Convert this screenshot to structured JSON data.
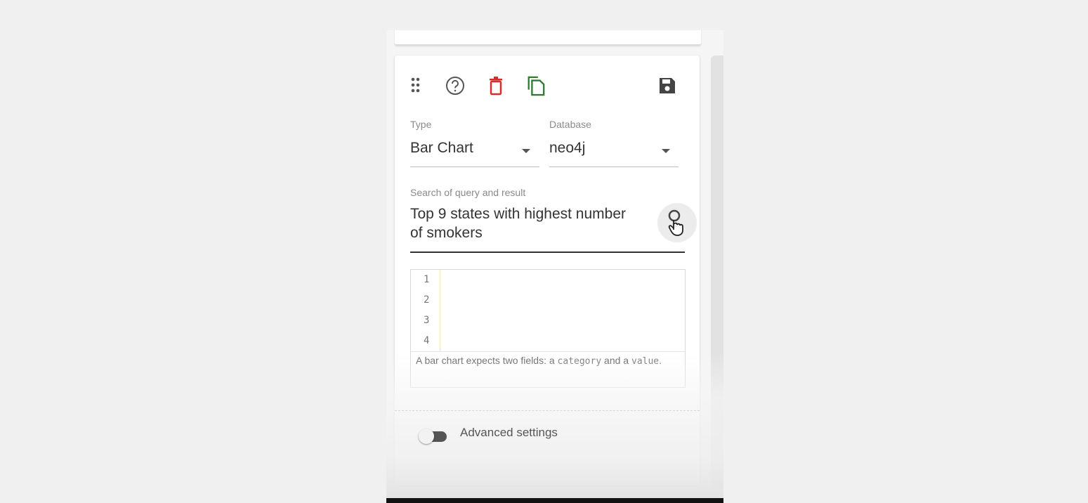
{
  "toolbar": {
    "icons": {
      "drag": "drag-handle-icon",
      "help": "help-circle-icon",
      "delete": "trash-icon",
      "duplicate": "copy-icon",
      "save": "save-icon"
    },
    "colors": {
      "delete": "#d32f2f",
      "duplicate": "#2e7d32",
      "default": "#555555"
    }
  },
  "type_select": {
    "label": "Type",
    "value": "Bar Chart"
  },
  "database_select": {
    "label": "Database",
    "value": "neo4j"
  },
  "search": {
    "label": "Search of query and result",
    "value": "Top 9 states with highest number of smokers",
    "button_icon": "search-submit-icon"
  },
  "editor": {
    "line_numbers": [
      "1",
      "2",
      "3",
      "4"
    ],
    "hint_prefix": "A bar chart expects two fields: a ",
    "hint_code1": "category",
    "hint_mid": " and a ",
    "hint_code2": "value",
    "hint_suffix": "."
  },
  "advanced": {
    "label": "Advanced settings",
    "enabled": false
  }
}
